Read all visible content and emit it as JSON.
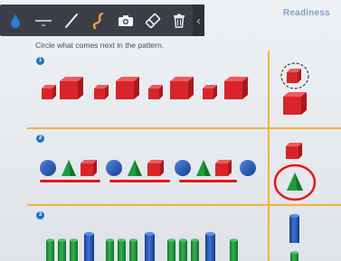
{
  "toolbar": {
    "tools": [
      "ink-drop",
      "thin-line",
      "pen",
      "highlighter",
      "camera",
      "eraser",
      "trash"
    ],
    "collapse_glyph": "‹"
  },
  "worksheet": {
    "title": "Readiness",
    "instruction": "Circle what comes next in the pattern.",
    "problems": [
      {
        "number": "1"
      },
      {
        "number": "2"
      },
      {
        "number": "3"
      }
    ]
  },
  "colors": {
    "toolbar": "#3b3e46",
    "ink_red": "#e51717",
    "cube_red": "#d9252a",
    "sphere_blue": "#1f55b8",
    "cone_green": "#1f9a3c",
    "cylinder_green": "#22913a",
    "cylinder_blue": "#2a5bb8",
    "divider_orange": "#f0b43e",
    "badge_blue": "#1f74c8",
    "title_blue": "#7fa3c7"
  }
}
